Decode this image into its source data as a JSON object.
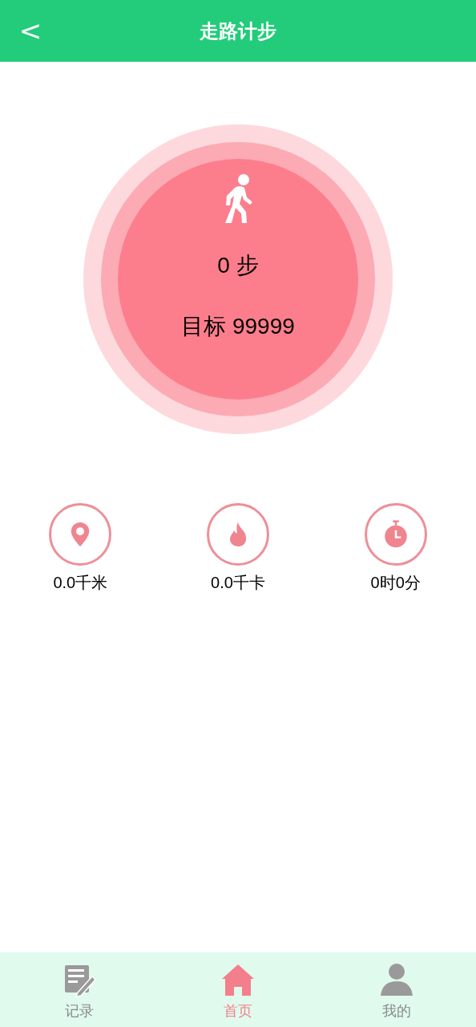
{
  "header": {
    "back": "<",
    "title": "走路计步"
  },
  "pedometer": {
    "steps": "0 步",
    "goal": "目标 99999"
  },
  "stats": [
    {
      "kind": "distance",
      "value": "0.0千米"
    },
    {
      "kind": "calories",
      "value": "0.0千卡"
    },
    {
      "kind": "time",
      "value": "0时0分"
    }
  ],
  "tabs": [
    {
      "kind": "record",
      "label": "记录",
      "selected": false
    },
    {
      "kind": "home",
      "label": "首页",
      "selected": true
    },
    {
      "kind": "profile",
      "label": "我的",
      "selected": false
    }
  ]
}
